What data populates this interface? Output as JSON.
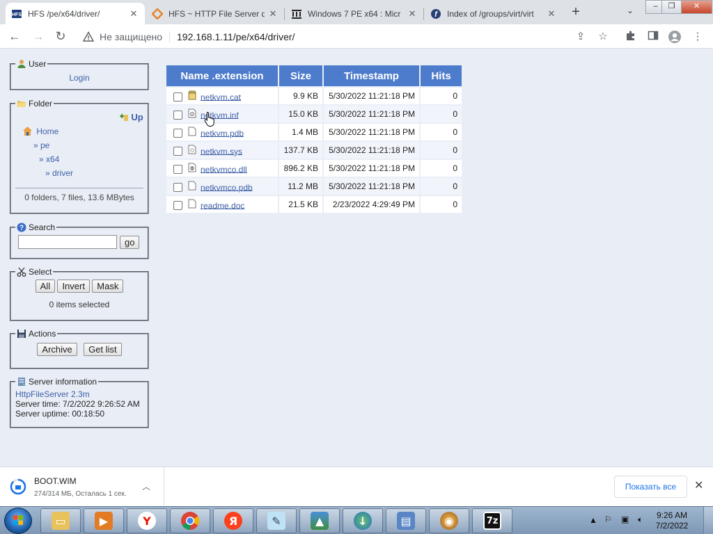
{
  "browser": {
    "tabs": [
      {
        "title": "HFS /pe/x64/driver/",
        "active": true
      },
      {
        "title": "HFS ~ HTTP File Server d",
        "active": false
      },
      {
        "title": "Windows 7 PE x64 : Micr",
        "active": false
      },
      {
        "title": "Index of /groups/virt/virt",
        "active": false
      }
    ],
    "address": {
      "security_label": "Не защищено",
      "url": "192.168.1.11/pe/x64/driver/"
    }
  },
  "sidebar": {
    "user": {
      "legend": "User",
      "login": "Login"
    },
    "folder": {
      "legend": "Folder",
      "up": "Up",
      "home": "Home",
      "crumbs": [
        "» pe",
        "» x64",
        "» driver"
      ],
      "summary": "0 folders, 7 files, 13.6 MBytes"
    },
    "search": {
      "legend": "Search",
      "input_value": "",
      "go": "go"
    },
    "select": {
      "legend": "Select",
      "buttons": [
        "All",
        "Invert",
        "Mask"
      ],
      "status": "0 items selected"
    },
    "actions": {
      "legend": "Actions",
      "archive": "Archive",
      "getlist": "Get list"
    },
    "server": {
      "legend": "Server information",
      "link": "HttpFileServer 2.3m",
      "time": "Server time: 7/2/2022 9:26:52 AM",
      "uptime": "Server uptime: 00:18:50"
    }
  },
  "table": {
    "headers": [
      "Name .extension",
      "Size",
      "Timestamp",
      "Hits"
    ],
    "rows": [
      {
        "name": "netkvm.cat",
        "size": "9.9 KB",
        "timestamp": "5/30/2022 11:21:18 PM",
        "hits": "0",
        "icon": "catalog-icon"
      },
      {
        "name": "netkvm.inf",
        "size": "15.0 KB",
        "timestamp": "5/30/2022 11:21:18 PM",
        "hits": "0",
        "icon": "inf-file-icon"
      },
      {
        "name": "netkvm.pdb",
        "size": "1.4 MB",
        "timestamp": "5/30/2022 11:21:18 PM",
        "hits": "0",
        "icon": "blank-file-icon"
      },
      {
        "name": "netkvm.sys",
        "size": "137.7 KB",
        "timestamp": "5/30/2022 11:21:18 PM",
        "hits": "0",
        "icon": "sys-file-icon"
      },
      {
        "name": "netkvmco.dll",
        "size": "896.2 KB",
        "timestamp": "5/30/2022 11:21:18 PM",
        "hits": "0",
        "icon": "dll-file-icon"
      },
      {
        "name": "netkvmco.pdb",
        "size": "11.2 MB",
        "timestamp": "5/30/2022 11:21:18 PM",
        "hits": "0",
        "icon": "blank-file-icon"
      },
      {
        "name": "readme.doc",
        "size": "21.5 KB",
        "timestamp": "2/23/2022 4:29:49 PM",
        "hits": "0",
        "icon": "blank-file-icon"
      }
    ]
  },
  "download": {
    "filename": "BOOT.WIM",
    "status": "274/314 МБ, Осталась 1 сек.",
    "show_all": "Показать все"
  },
  "taskbar": {
    "time": "9:26 AM",
    "date": "7/2/2022",
    "apps": [
      "explorer",
      "media-player",
      "yandex-browser",
      "chrome",
      "yandex",
      "notepad",
      "image-viewer",
      "internet-download-manager",
      "network-center",
      "hfs",
      "7zip"
    ],
    "sevenzip_label": "7z"
  },
  "colors": {
    "header_blue": "#4e7ccc",
    "link_blue": "#3d5fa7",
    "page_bg": "#e9eef6"
  }
}
